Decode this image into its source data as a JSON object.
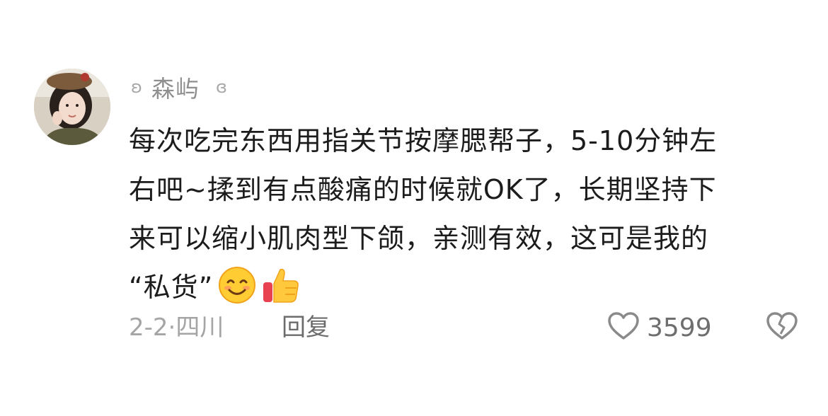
{
  "comment": {
    "author": {
      "name": "森屿",
      "level_icon": "level-icon",
      "badge_icon": "badge-icon"
    },
    "lines": [
      "每次吃完东西用指关节按摩腮帮子，5-10分钟左",
      "右吧~揉到有点酸痛的时候就OK了，长期坚持下",
      "来可以缩小肌肉型下颌，亲测有效，这可是我的",
      "“私货”"
    ],
    "emojis": [
      "smiling-face-icon",
      "thumbs-up-icon"
    ],
    "date": "2-2·",
    "location": "四川",
    "reply_label": "回复",
    "like_count": "3599",
    "colors": {
      "text": "#1c1c1c",
      "meta": "#a5a5a5",
      "icon": "#8a8a8a"
    }
  }
}
